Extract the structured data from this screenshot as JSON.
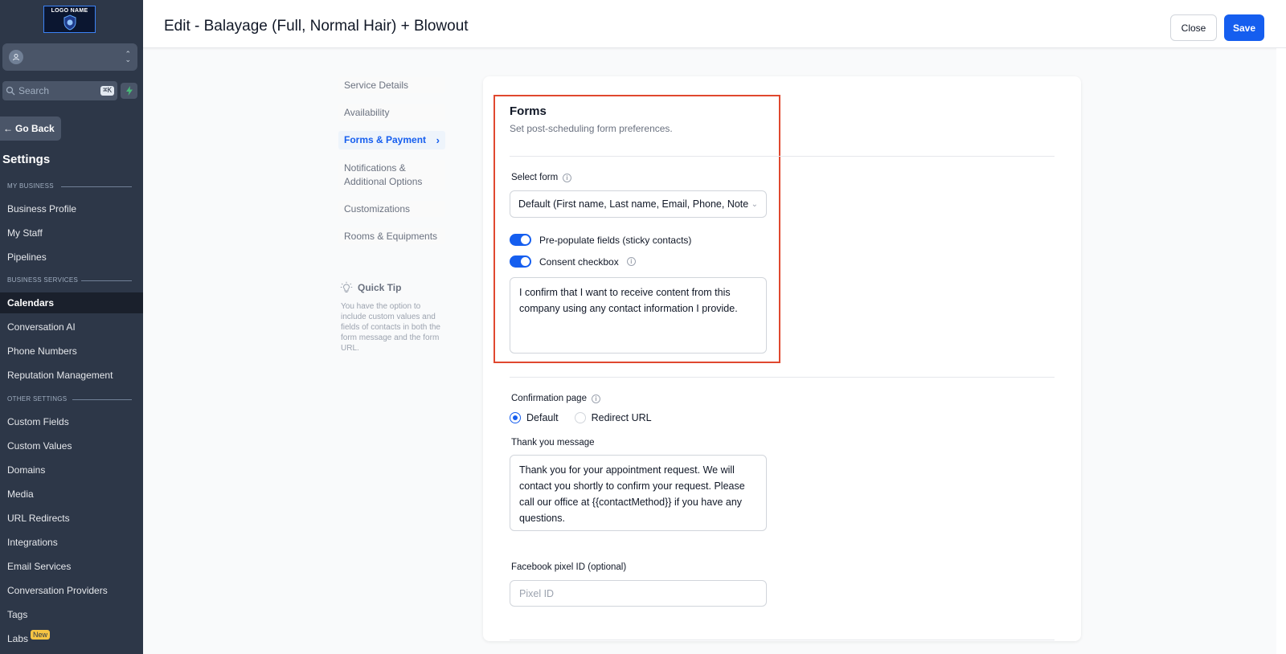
{
  "sidebar": {
    "logo_text": "LOGO NAME",
    "search_placeholder": "Search",
    "search_shortcut": "⌘K",
    "go_back": "Go Back",
    "settings_title": "Settings",
    "sections": {
      "my_business": "MY BUSINESS",
      "business_services": "BUSINESS SERVICES",
      "other_settings": "OTHER SETTINGS"
    },
    "items": [
      {
        "label": "Business Profile"
      },
      {
        "label": "My Staff"
      },
      {
        "label": "Pipelines"
      },
      {
        "label": "Calendars",
        "active": true
      },
      {
        "label": "Conversation AI"
      },
      {
        "label": "Phone Numbers"
      },
      {
        "label": "Reputation Management"
      },
      {
        "label": "Custom Fields"
      },
      {
        "label": "Custom Values"
      },
      {
        "label": "Domains"
      },
      {
        "label": "Media"
      },
      {
        "label": "URL Redirects"
      },
      {
        "label": "Integrations"
      },
      {
        "label": "Email Services"
      },
      {
        "label": "Conversation Providers"
      },
      {
        "label": "Tags"
      },
      {
        "label": "Labs",
        "badge": "New"
      }
    ]
  },
  "header": {
    "title": "Edit - Balayage (Full, Normal Hair) + Blowout",
    "close_label": "Close",
    "save_label": "Save"
  },
  "subnav": {
    "items": [
      {
        "label": "Service Details"
      },
      {
        "label": "Availability"
      },
      {
        "label": "Forms & Payment",
        "active": true
      },
      {
        "label": "Notifications & Additional Options"
      },
      {
        "label": "Customizations"
      },
      {
        "label": "Rooms & Equipments"
      }
    ],
    "quick_tip": {
      "title": "Quick Tip",
      "body": "You have the option to include custom values and fields of contacts in both the form message and the form URL."
    }
  },
  "forms": {
    "title": "Forms",
    "subtitle": "Set post-scheduling form preferences.",
    "select_form_label": "Select form",
    "select_form_value": "Default (First name, Last name, Email, Phone, Note",
    "prepopulate_label": "Pre-populate fields (sticky contacts)",
    "prepopulate_on": true,
    "consent_label": "Consent checkbox",
    "consent_on": true,
    "consent_text": "I confirm that I want to receive content from this company using any contact information I provide."
  },
  "confirmation": {
    "label": "Confirmation page",
    "options": [
      "Default",
      "Redirect URL"
    ],
    "selected": "Default",
    "thank_you_label": "Thank you message",
    "thank_you_text": "Thank you for your appointment request. We will contact you shortly to confirm your request. Please call our office at {{contactMethod}} if you have any questions.",
    "pixel_label": "Facebook pixel ID (optional)",
    "pixel_placeholder": "Pixel ID",
    "pixel_value": ""
  },
  "colors": {
    "accent": "#155eef",
    "sidebar_bg": "#2d3748",
    "highlight": "#e0482f",
    "badge": "#f6c443"
  }
}
